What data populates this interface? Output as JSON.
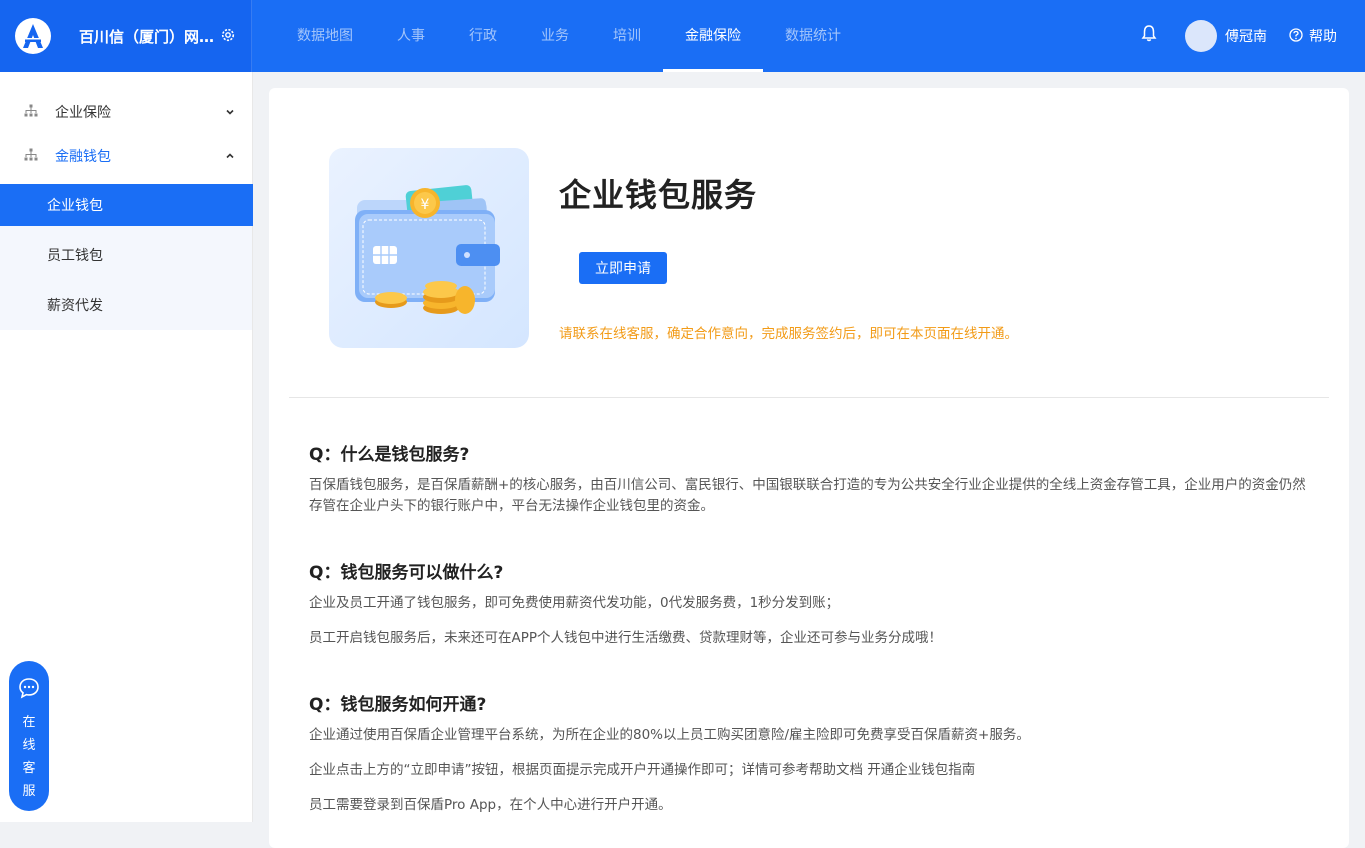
{
  "header": {
    "company": "百川信（厦门）网络...",
    "nav": [
      "数据地图",
      "人事",
      "行政",
      "业务",
      "培训",
      "金融保险",
      "数据统计"
    ],
    "active_nav": "金融保险",
    "username": "傅冠南",
    "help": "帮助"
  },
  "sidebar": {
    "groups": [
      {
        "label": "企业保险",
        "state": "collapsed"
      },
      {
        "label": "金融钱包",
        "state": "expanded"
      }
    ],
    "subitems": [
      {
        "label": "企业钱包",
        "active": true
      },
      {
        "label": "员工钱包",
        "active": false
      },
      {
        "label": "薪资代发",
        "active": false
      }
    ]
  },
  "service": {
    "label": "在线客服",
    "chars": [
      "在",
      "线",
      "客",
      "服"
    ]
  },
  "main": {
    "title": "企业钱包服务",
    "apply_button": "立即申请",
    "notice": "请联系在线客服，确定合作意向，完成服务签约后，即可在本页面在线开通。",
    "faq": [
      {
        "q": "Q：什么是钱包服务?",
        "a": [
          "百保盾钱包服务，是百保盾薪酬+的核心服务，由百川信公司、富民银行、中国银联联合打造的专为公共安全行业企业提供的全线上资金存管工具，企业用户的资金仍然存管在企业户头下的银行账户中，平台无法操作企业钱包里的资金。"
        ]
      },
      {
        "q": "Q：钱包服务可以做什么?",
        "a": [
          "企业及员工开通了钱包服务，即可免费使用薪资代发功能，0代发服务费，1秒分发到账；",
          "员工开启钱包服务后，未来还可在APP个人钱包中进行生活缴费、贷款理财等，企业还可参与业务分成哦！"
        ]
      },
      {
        "q": "Q：钱包服务如何开通?",
        "a": [
          "企业通过使用百保盾企业管理平台系统，为所在企业的80%以上员工购买团意险/雇主险即可免费享受百保盾薪资+服务。",
          "企业点击上方的“立即申请”按钮，根据页面提示完成开户开通操作即可；详情可参考帮助文档 开通企业钱包指南",
          "员工需要登录到百保盾Pro App，在个人中心进行开户开通。"
        ]
      }
    ]
  },
  "colors": {
    "primary": "#1a6ef5",
    "notice": "#f29b17",
    "sidebar_active_bg": "#1a6ef5"
  }
}
